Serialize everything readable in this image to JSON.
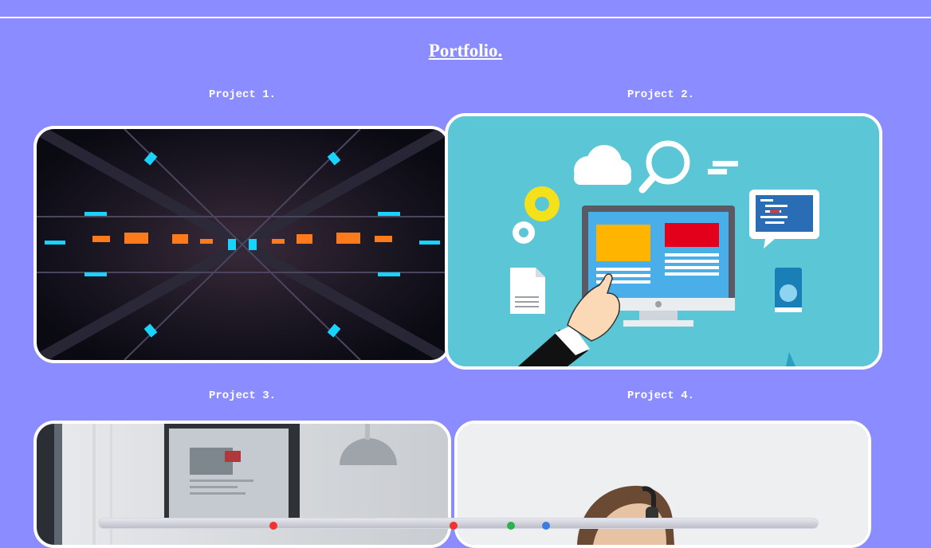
{
  "page": {
    "title": "Portfolio."
  },
  "projects": [
    {
      "label": "Project 1.",
      "image": "sci-fi-tunnel-image"
    },
    {
      "label": "Project 2.",
      "image": "web-development-illustration"
    },
    {
      "label": "Project 3.",
      "image": "computer-desk-photo"
    },
    {
      "label": "Project 4.",
      "image": "person-with-headset-photo"
    }
  ],
  "colors": {
    "background": "#8a8cff",
    "card_border": "#ffffff",
    "illustration_bg": "#5bc6d6"
  }
}
